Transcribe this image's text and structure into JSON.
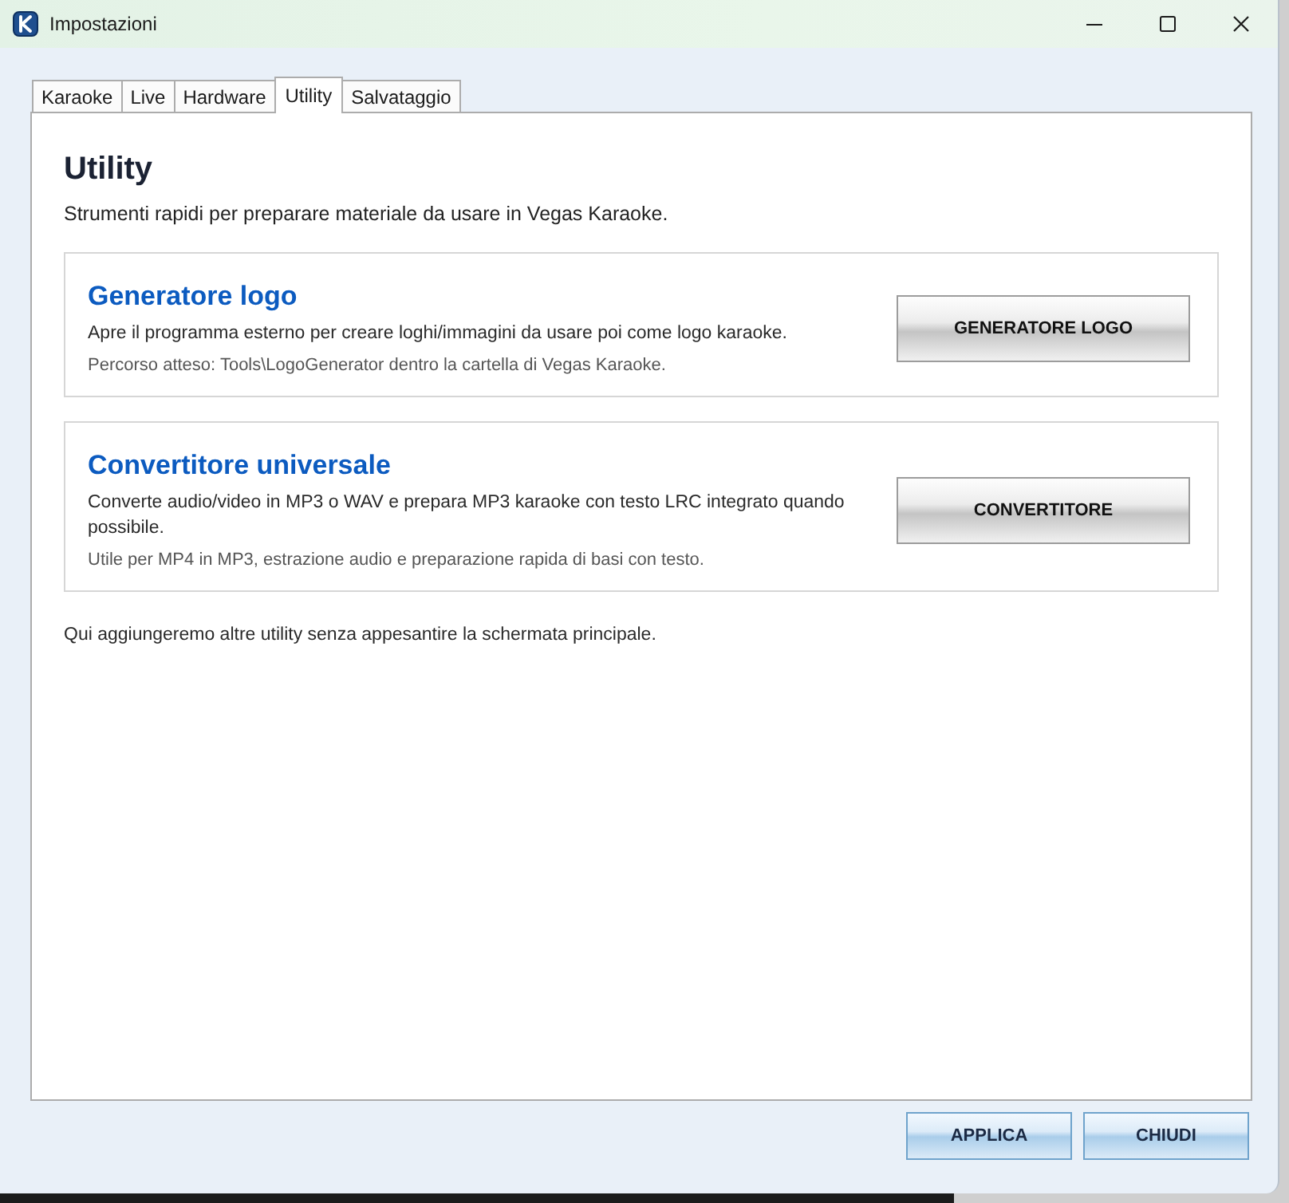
{
  "window": {
    "title": "Impostazioni"
  },
  "tabs": [
    {
      "label": "Karaoke",
      "selected": false
    },
    {
      "label": "Live",
      "selected": false
    },
    {
      "label": "Hardware",
      "selected": false
    },
    {
      "label": "Utility",
      "selected": true
    },
    {
      "label": "Salvataggio",
      "selected": false
    }
  ],
  "page": {
    "heading": "Utility",
    "description": "Strumenti rapidi per preparare materiale da usare in Vegas Karaoke."
  },
  "tools": [
    {
      "title": "Generatore logo",
      "description": "Apre il programma esterno per creare loghi/immagini da usare poi come logo karaoke.",
      "note": "Percorso atteso: Tools\\LogoGenerator dentro la cartella di Vegas Karaoke.",
      "button": "GENERATORE LOGO"
    },
    {
      "title": "Convertitore universale",
      "description": "Converte audio/video in MP3 o WAV e prepara MP3 karaoke con testo LRC integrato quando possibile.",
      "note": "Utile per MP4 in MP3, estrazione audio e preparazione rapida di basi con testo.",
      "button": "CONVERTITORE"
    }
  ],
  "footer_note": "Qui aggiungeremo altre utility senza appesantire la schermata principale.",
  "buttons": [
    "APPLICA",
    "CHIUDI"
  ]
}
